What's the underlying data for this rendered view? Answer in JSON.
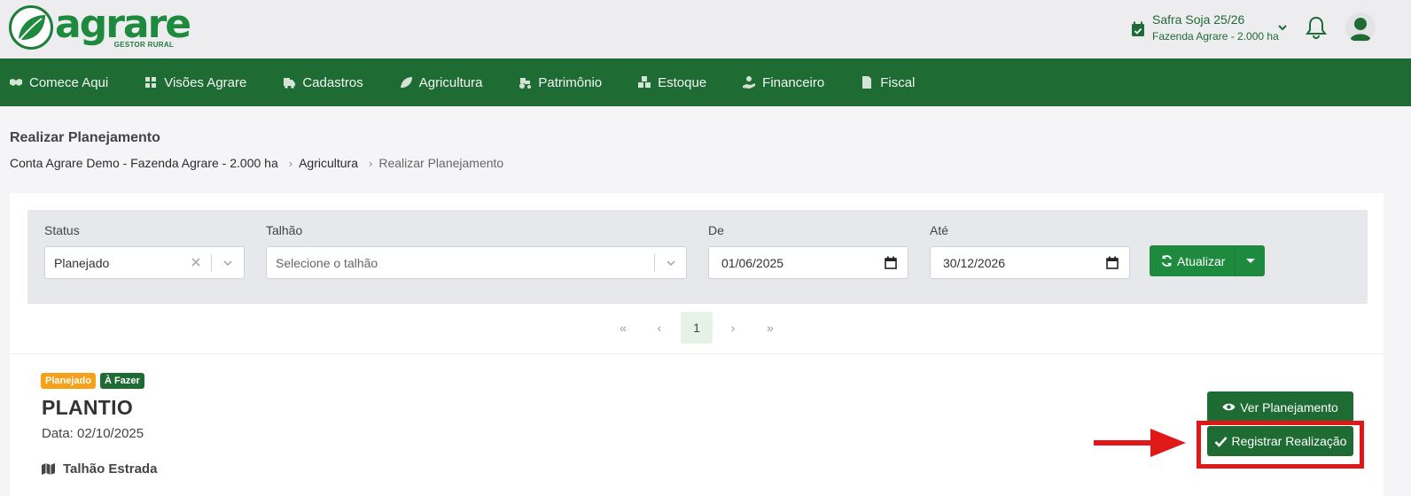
{
  "header": {
    "logo_word": "agrare",
    "logo_sub": "GESTOR RURAL",
    "safra_title": "Safra Soja 25/26",
    "safra_sub": "Fazenda Agrare - 2.000 ha"
  },
  "nav": {
    "items": [
      {
        "label": "Comece Aqui",
        "icon": "handshake-icon"
      },
      {
        "label": "Visões Agrare",
        "icon": "dashboard-icon"
      },
      {
        "label": "Cadastros",
        "icon": "truck-icon"
      },
      {
        "label": "Agricultura",
        "icon": "leaf-icon"
      },
      {
        "label": "Patrimônio",
        "icon": "tractor-icon"
      },
      {
        "label": "Estoque",
        "icon": "boxes-icon"
      },
      {
        "label": "Financeiro",
        "icon": "hand-money-icon"
      },
      {
        "label": "Fiscal",
        "icon": "invoice-icon"
      }
    ]
  },
  "page": {
    "title": "Realizar Planejamento",
    "breadcrumb": [
      "Conta Agrare Demo - Fazenda Agrare - 2.000 ha",
      "Agricultura",
      "Realizar Planejamento"
    ]
  },
  "filters": {
    "status_label": "Status",
    "status_value": "Planejado",
    "talhao_label": "Talhão",
    "talhao_placeholder": "Selecione o talhão",
    "de_label": "De",
    "de_value": "01/06/2025",
    "ate_label": "Até",
    "ate_value": "30/12/2026",
    "atualizar_label": "Atualizar"
  },
  "pager": {
    "first": "«",
    "prev": "‹",
    "current": "1",
    "next": "›",
    "last": "»"
  },
  "operation": {
    "badge_status": "Planejado",
    "badge_todo": "À Fazer",
    "title": "PLANTIO",
    "date": "Data: 02/10/2025",
    "talhao": "Talhão Estrada",
    "ver_label": "Ver Planejamento",
    "registrar_label": "Registrar Realização"
  },
  "colors": {
    "brand_green": "#1e6b34",
    "button_green": "#1e8a3e",
    "badge_orange": "#f6a11a",
    "highlight_red": "#e01818"
  }
}
